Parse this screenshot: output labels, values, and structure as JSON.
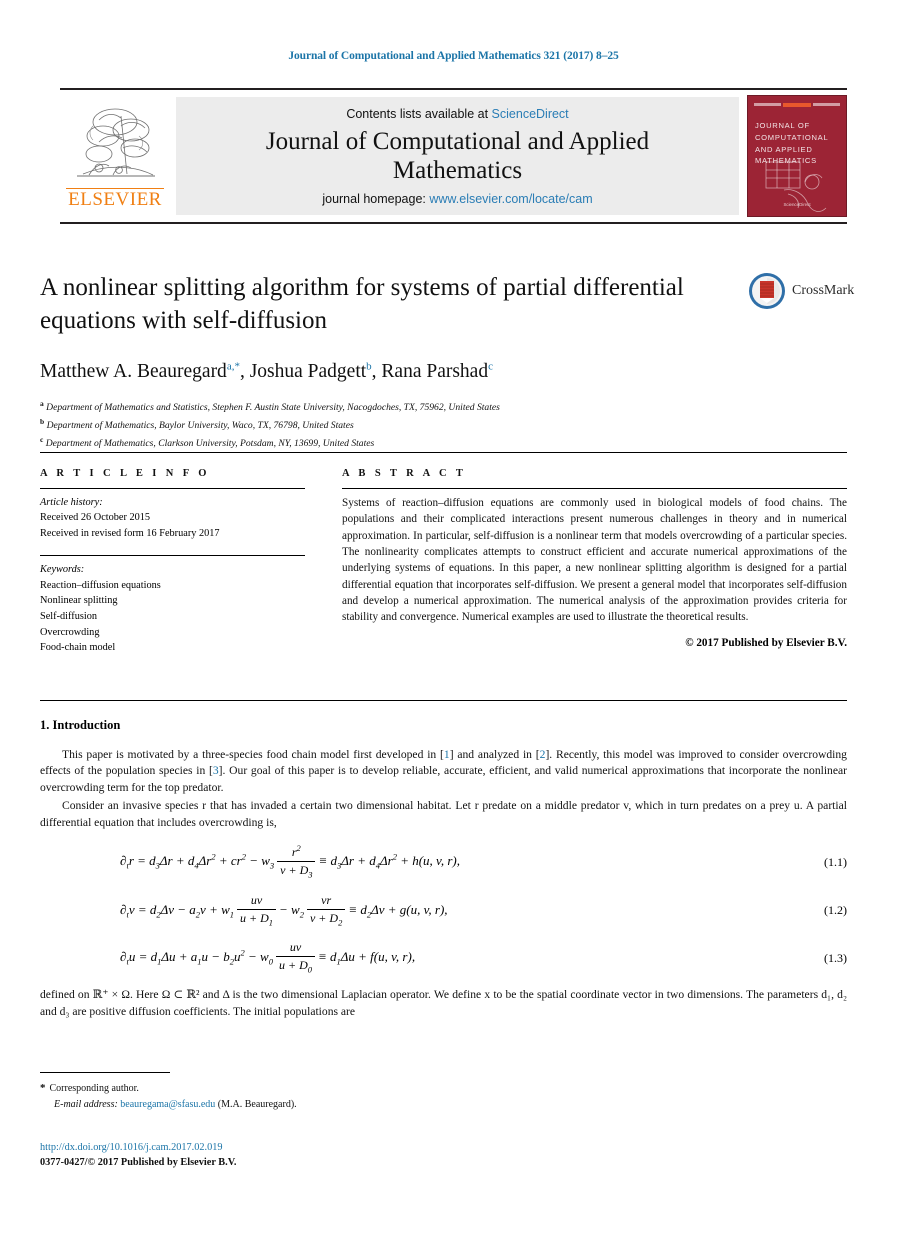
{
  "running_head": "Journal of Computational and Applied Mathematics 321 (2017) 8–25",
  "masthead": {
    "publisher": "ELSEVIER",
    "contents_prefix": "Contents lists available at",
    "contents_link": "ScienceDirect",
    "journal_title_line1": "Journal of Computational and Applied",
    "journal_title_line2": "Mathematics",
    "homepage_prefix": "journal homepage:",
    "homepage_link": "www.elsevier.com/locate/cam",
    "cover_title": "JOURNAL OF COMPUTATIONAL AND APPLIED MATHEMATICS",
    "cover_footer": "ScienceDirect"
  },
  "article": {
    "title": "A nonlinear splitting algorithm for systems of partial differential equations with self-diffusion",
    "crossmark_label": "CrossMark",
    "authors": [
      {
        "name": "Matthew A. Beauregard",
        "marks": "a,*"
      },
      {
        "name": "Joshua Padgett",
        "marks": "b"
      },
      {
        "name": "Rana Parshad",
        "marks": "c"
      }
    ],
    "affiliations": [
      {
        "mark": "a",
        "text": "Department of Mathematics and Statistics, Stephen F. Austin State University, Nacogdoches, TX, 75962, United States"
      },
      {
        "mark": "b",
        "text": "Department of Mathematics, Baylor University, Waco, TX, 76798, United States"
      },
      {
        "mark": "c",
        "text": "Department of Mathematics, Clarkson University, Potsdam, NY, 13699, United States"
      }
    ]
  },
  "info": {
    "heading": "A R T I C L E    I N F O",
    "history_label": "Article history:",
    "history": [
      "Received 26 October 2015",
      "Received in revised form 16 February 2017"
    ],
    "keywords_label": "Keywords:",
    "keywords": [
      "Reaction–diffusion equations",
      "Nonlinear splitting",
      "Self-diffusion",
      "Overcrowding",
      "Food-chain model"
    ]
  },
  "abstract": {
    "heading": "A B S T R A C T",
    "text": "Systems of reaction–diffusion equations are commonly used in biological models of food chains. The populations and their complicated interactions present numerous challenges in theory and in numerical approximation. In particular, self-diffusion is a nonlinear term that models overcrowding of a particular species. The nonlinearity complicates attempts to construct efficient and accurate numerical approximations of the underlying systems of equations. In this paper, a new nonlinear splitting algorithm is designed for a partial differential equation that incorporates self-diffusion. We present a general model that incorporates self-diffusion and develop a numerical approximation. The numerical analysis of the approximation provides criteria for stability and convergence. Numerical examples are used to illustrate the theoretical results.",
    "copyright": "© 2017 Published by Elsevier B.V."
  },
  "body": {
    "section_heading": "1. Introduction",
    "paragraph1_part1": "This paper is motivated by a three-species food chain model first developed in [",
    "cite1": "1",
    "paragraph1_part2": "] and analyzed in [",
    "cite2": "2",
    "paragraph1_part3": "]. Recently, this model was improved to consider overcrowding effects of the population species in [",
    "cite3": "3",
    "paragraph1_part4": "]. Our goal of this paper is to develop reliable, accurate, efficient, and valid numerical approximations that incorporate the nonlinear overcrowding term for the top predator.",
    "paragraph2": "Consider an invasive species r that has invaded a certain two dimensional habitat. Let r predate on a middle predator v, which in turn predates on a prey u. A partial differential equation that includes overcrowding is,",
    "paragraph3": "defined on ℝ⁺ × Ω. Here Ω ⊂ ℝ² and Δ is the two dimensional Laplacian operator. We define x to be the spatial coordinate vector in two dimensions. The parameters d₁, d₂ and d₃ are positive diffusion coefficients. The initial populations are",
    "equations": [
      {
        "number": "(1.1)"
      },
      {
        "number": "(1.2)"
      },
      {
        "number": "(1.3)"
      }
    ]
  },
  "footnotes": {
    "corresponding": "Corresponding author.",
    "email_label": "E-mail address:",
    "email": "beauregama@sfasu.edu",
    "email_owner": "(M.A. Beauregard).",
    "doi": "http://dx.doi.org/10.1016/j.cam.2017.02.019",
    "issn": "0377-0427/© 2017 Published by Elsevier B.V."
  },
  "colors": {
    "link": "#1c75a8",
    "elsevier_orange": "#f07f13",
    "cover_red": "#9c2435"
  }
}
